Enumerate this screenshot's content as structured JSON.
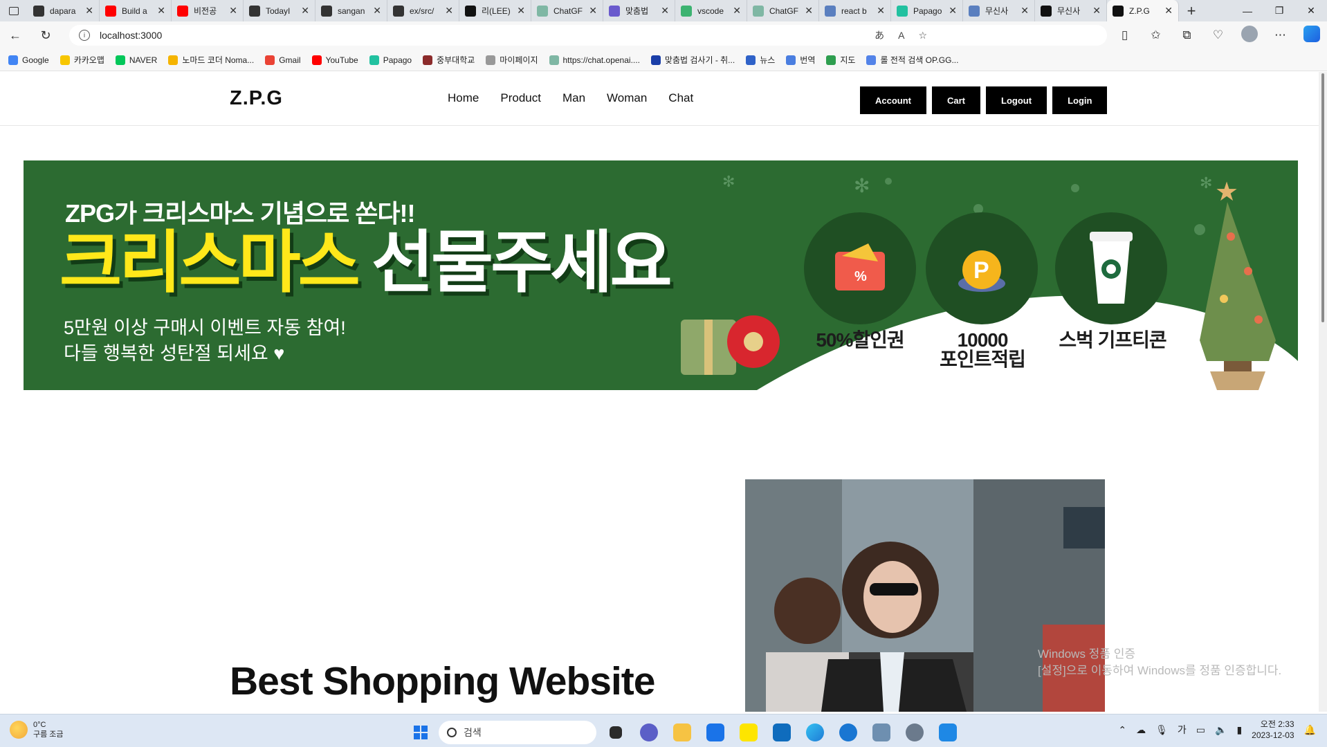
{
  "browser": {
    "tabs": [
      {
        "label": "dapara",
        "color": "#333333"
      },
      {
        "label": "Build a",
        "color": "#ff0000"
      },
      {
        "label": "비전공",
        "color": "#ff0000"
      },
      {
        "label": "TodayI",
        "color": "#333333"
      },
      {
        "label": "sangan",
        "color": "#333333"
      },
      {
        "label": "ex/src/",
        "color": "#333333"
      },
      {
        "label": "리(LEE)",
        "color": "#111111"
      },
      {
        "label": "ChatGF",
        "color": "#7fb7a4"
      },
      {
        "label": "맞춤법",
        "color": "#6a5acd"
      },
      {
        "label": "vscode",
        "color": "#3cb371"
      },
      {
        "label": "ChatGF",
        "color": "#7fb7a4"
      },
      {
        "label": "react b",
        "color": "#5a7fbf"
      },
      {
        "label": "Papago",
        "color": "#22c1a0"
      },
      {
        "label": "무신사",
        "color": "#5a7fbf"
      },
      {
        "label": "무신사",
        "color": "#111111"
      },
      {
        "label": "Z.P.G",
        "color": "#111111",
        "active": true
      }
    ],
    "new_tab": "+",
    "url": "localhost:3000",
    "bookmarks": [
      {
        "label": "Google",
        "color": "#4285f4"
      },
      {
        "label": "카카오맵",
        "color": "#f7c600"
      },
      {
        "label": "NAVER",
        "color": "#03c75a"
      },
      {
        "label": "노마드 코더 Noma...",
        "color": "#f5b400"
      },
      {
        "label": "Gmail",
        "color": "#ea4335"
      },
      {
        "label": "YouTube",
        "color": "#ff0000"
      },
      {
        "label": "Papago",
        "color": "#22c1a0"
      },
      {
        "label": "중부대학교",
        "color": "#8b2b2b"
      },
      {
        "label": "마이페이지",
        "color": "#999999"
      },
      {
        "label": "https://chat.openai....",
        "color": "#7fb7a4"
      },
      {
        "label": "맞춤법 검사기 - 취...",
        "color": "#1a3ea8"
      },
      {
        "label": "뉴스",
        "color": "#2f62c8"
      },
      {
        "label": "번역",
        "color": "#4a7ee0"
      },
      {
        "label": "지도",
        "color": "#2e9e4f"
      },
      {
        "label": "롤 전적 검색 OP.GG...",
        "color": "#5383e8"
      }
    ]
  },
  "site": {
    "logo": "Z.P.G",
    "nav": [
      "Home",
      "Product",
      "Man",
      "Woman",
      "Chat"
    ],
    "buttons": [
      "Account",
      "Cart",
      "Logout",
      "Login"
    ],
    "banner": {
      "line1": "ZPG가 크리스마스 기념으로 쏜다!!",
      "line2_yellow": "크리스마스",
      "line2_white": "선물주세요",
      "sub1": "5만원 이상 구매시 이벤트 자동 참여!",
      "sub2": "다들 행복한 성탄절 되세요 ♥",
      "rewards": [
        "50%할인권",
        "10000\n포인트적립",
        "스벅 기프티콘"
      ],
      "background": "#2c6b31"
    },
    "headline": "Best Shopping Website"
  },
  "os": {
    "watermark_line1": "Windows 정품 인증",
    "watermark_line2": "[설정]으로 이동하여 Windows를 정품 인증합니다.",
    "weather_temp": "0°C",
    "weather_desc": "구름 조금",
    "search_placeholder": "검색",
    "clock_time": "오전 2:33",
    "clock_date": "2023-12-03",
    "ime": "가"
  }
}
